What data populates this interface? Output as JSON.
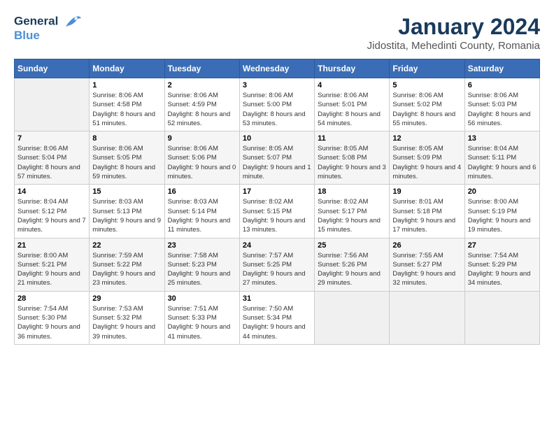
{
  "logo": {
    "line1": "General",
    "line2": "Blue"
  },
  "title": "January 2024",
  "subtitle": "Jidostita, Mehedinti County, Romania",
  "weekdays": [
    "Sunday",
    "Monday",
    "Tuesday",
    "Wednesday",
    "Thursday",
    "Friday",
    "Saturday"
  ],
  "weeks": [
    [
      {
        "day": "",
        "sunrise": "",
        "sunset": "",
        "daylight": "",
        "empty": true
      },
      {
        "day": "1",
        "sunrise": "Sunrise: 8:06 AM",
        "sunset": "Sunset: 4:58 PM",
        "daylight": "Daylight: 8 hours and 51 minutes."
      },
      {
        "day": "2",
        "sunrise": "Sunrise: 8:06 AM",
        "sunset": "Sunset: 4:59 PM",
        "daylight": "Daylight: 8 hours and 52 minutes."
      },
      {
        "day": "3",
        "sunrise": "Sunrise: 8:06 AM",
        "sunset": "Sunset: 5:00 PM",
        "daylight": "Daylight: 8 hours and 53 minutes."
      },
      {
        "day": "4",
        "sunrise": "Sunrise: 8:06 AM",
        "sunset": "Sunset: 5:01 PM",
        "daylight": "Daylight: 8 hours and 54 minutes."
      },
      {
        "day": "5",
        "sunrise": "Sunrise: 8:06 AM",
        "sunset": "Sunset: 5:02 PM",
        "daylight": "Daylight: 8 hours and 55 minutes."
      },
      {
        "day": "6",
        "sunrise": "Sunrise: 8:06 AM",
        "sunset": "Sunset: 5:03 PM",
        "daylight": "Daylight: 8 hours and 56 minutes."
      }
    ],
    [
      {
        "day": "7",
        "sunrise": "Sunrise: 8:06 AM",
        "sunset": "Sunset: 5:04 PM",
        "daylight": "Daylight: 8 hours and 57 minutes."
      },
      {
        "day": "8",
        "sunrise": "Sunrise: 8:06 AM",
        "sunset": "Sunset: 5:05 PM",
        "daylight": "Daylight: 8 hours and 59 minutes."
      },
      {
        "day": "9",
        "sunrise": "Sunrise: 8:06 AM",
        "sunset": "Sunset: 5:06 PM",
        "daylight": "Daylight: 9 hours and 0 minutes."
      },
      {
        "day": "10",
        "sunrise": "Sunrise: 8:05 AM",
        "sunset": "Sunset: 5:07 PM",
        "daylight": "Daylight: 9 hours and 1 minute."
      },
      {
        "day": "11",
        "sunrise": "Sunrise: 8:05 AM",
        "sunset": "Sunset: 5:08 PM",
        "daylight": "Daylight: 9 hours and 3 minutes."
      },
      {
        "day": "12",
        "sunrise": "Sunrise: 8:05 AM",
        "sunset": "Sunset: 5:09 PM",
        "daylight": "Daylight: 9 hours and 4 minutes."
      },
      {
        "day": "13",
        "sunrise": "Sunrise: 8:04 AM",
        "sunset": "Sunset: 5:11 PM",
        "daylight": "Daylight: 9 hours and 6 minutes."
      }
    ],
    [
      {
        "day": "14",
        "sunrise": "Sunrise: 8:04 AM",
        "sunset": "Sunset: 5:12 PM",
        "daylight": "Daylight: 9 hours and 7 minutes."
      },
      {
        "day": "15",
        "sunrise": "Sunrise: 8:03 AM",
        "sunset": "Sunset: 5:13 PM",
        "daylight": "Daylight: 9 hours and 9 minutes."
      },
      {
        "day": "16",
        "sunrise": "Sunrise: 8:03 AM",
        "sunset": "Sunset: 5:14 PM",
        "daylight": "Daylight: 9 hours and 11 minutes."
      },
      {
        "day": "17",
        "sunrise": "Sunrise: 8:02 AM",
        "sunset": "Sunset: 5:15 PM",
        "daylight": "Daylight: 9 hours and 13 minutes."
      },
      {
        "day": "18",
        "sunrise": "Sunrise: 8:02 AM",
        "sunset": "Sunset: 5:17 PM",
        "daylight": "Daylight: 9 hours and 15 minutes."
      },
      {
        "day": "19",
        "sunrise": "Sunrise: 8:01 AM",
        "sunset": "Sunset: 5:18 PM",
        "daylight": "Daylight: 9 hours and 17 minutes."
      },
      {
        "day": "20",
        "sunrise": "Sunrise: 8:00 AM",
        "sunset": "Sunset: 5:19 PM",
        "daylight": "Daylight: 9 hours and 19 minutes."
      }
    ],
    [
      {
        "day": "21",
        "sunrise": "Sunrise: 8:00 AM",
        "sunset": "Sunset: 5:21 PM",
        "daylight": "Daylight: 9 hours and 21 minutes."
      },
      {
        "day": "22",
        "sunrise": "Sunrise: 7:59 AM",
        "sunset": "Sunset: 5:22 PM",
        "daylight": "Daylight: 9 hours and 23 minutes."
      },
      {
        "day": "23",
        "sunrise": "Sunrise: 7:58 AM",
        "sunset": "Sunset: 5:23 PM",
        "daylight": "Daylight: 9 hours and 25 minutes."
      },
      {
        "day": "24",
        "sunrise": "Sunrise: 7:57 AM",
        "sunset": "Sunset: 5:25 PM",
        "daylight": "Daylight: 9 hours and 27 minutes."
      },
      {
        "day": "25",
        "sunrise": "Sunrise: 7:56 AM",
        "sunset": "Sunset: 5:26 PM",
        "daylight": "Daylight: 9 hours and 29 minutes."
      },
      {
        "day": "26",
        "sunrise": "Sunrise: 7:55 AM",
        "sunset": "Sunset: 5:27 PM",
        "daylight": "Daylight: 9 hours and 32 minutes."
      },
      {
        "day": "27",
        "sunrise": "Sunrise: 7:54 AM",
        "sunset": "Sunset: 5:29 PM",
        "daylight": "Daylight: 9 hours and 34 minutes."
      }
    ],
    [
      {
        "day": "28",
        "sunrise": "Sunrise: 7:54 AM",
        "sunset": "Sunset: 5:30 PM",
        "daylight": "Daylight: 9 hours and 36 minutes."
      },
      {
        "day": "29",
        "sunrise": "Sunrise: 7:53 AM",
        "sunset": "Sunset: 5:32 PM",
        "daylight": "Daylight: 9 hours and 39 minutes."
      },
      {
        "day": "30",
        "sunrise": "Sunrise: 7:51 AM",
        "sunset": "Sunset: 5:33 PM",
        "daylight": "Daylight: 9 hours and 41 minutes."
      },
      {
        "day": "31",
        "sunrise": "Sunrise: 7:50 AM",
        "sunset": "Sunset: 5:34 PM",
        "daylight": "Daylight: 9 hours and 44 minutes."
      },
      {
        "day": "",
        "sunrise": "",
        "sunset": "",
        "daylight": "",
        "empty": true
      },
      {
        "day": "",
        "sunrise": "",
        "sunset": "",
        "daylight": "",
        "empty": true
      },
      {
        "day": "",
        "sunrise": "",
        "sunset": "",
        "daylight": "",
        "empty": true
      }
    ]
  ]
}
